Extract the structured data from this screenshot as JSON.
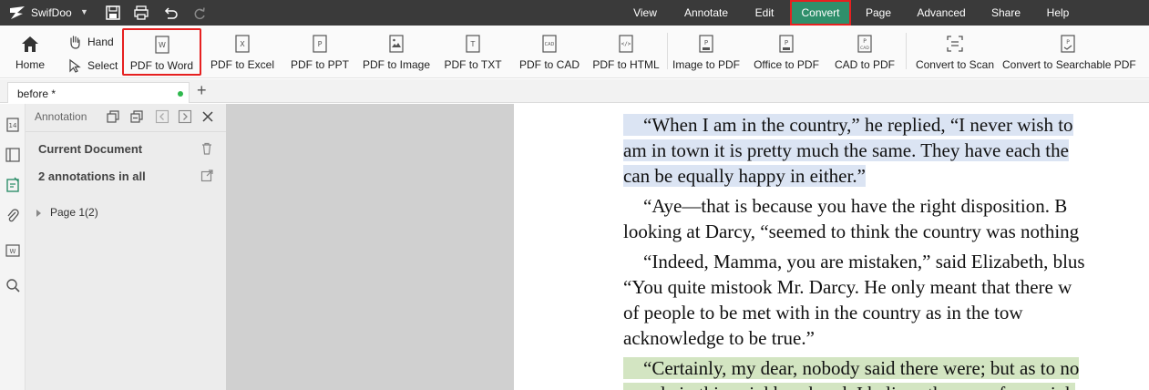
{
  "app": {
    "name": "SwifDoo",
    "menu": [
      "View",
      "Annotate",
      "Edit",
      "Convert",
      "Page",
      "Advanced",
      "Share",
      "Help"
    ],
    "active_menu": "Convert"
  },
  "ribbon": {
    "home": "Home",
    "hand": "Hand",
    "select": "Select",
    "buttons": [
      "PDF to Word",
      "PDF to Excel",
      "PDF to PPT",
      "PDF to Image",
      "PDF to TXT",
      "PDF to CAD",
      "PDF to HTML",
      "Image to PDF",
      "Office to PDF",
      "CAD to PDF",
      "Convert to Scan",
      "Convert to Searchable PDF"
    ]
  },
  "tabs": {
    "doc": "before *"
  },
  "panel": {
    "title": "Annotation",
    "current_document": "Current Document",
    "count": "2 annotations in all",
    "page_node": "Page 1(2)"
  },
  "document": {
    "lines": [
      "“When I am in the country,” he replied, “I never wish to",
      "am in town it is pretty much the same. They have each the",
      "can be equally happy in either.”",
      "“Aye—that is because you have the right disposition. B",
      "looking at Darcy, “seemed to think the country was nothing",
      "“Indeed, Mamma, you are mistaken,” said Elizabeth, blus",
      "“You quite mistook Mr. Darcy. He only meant that there w",
      "of people to be met with in the country as in the tow",
      "acknowledge to be true.”",
      "“Certainly, my dear, nobody said there were; but as to no",
      "people in this neighbourhood. I believe there are few neigh"
    ]
  },
  "colors": {
    "titlebar": "#3a3a3a",
    "active_menu_bg": "#2f8f6b",
    "highlight_border": "#e62020",
    "annotation_blue": "#dbe4f3",
    "annotation_green": "#d3e5c2"
  }
}
